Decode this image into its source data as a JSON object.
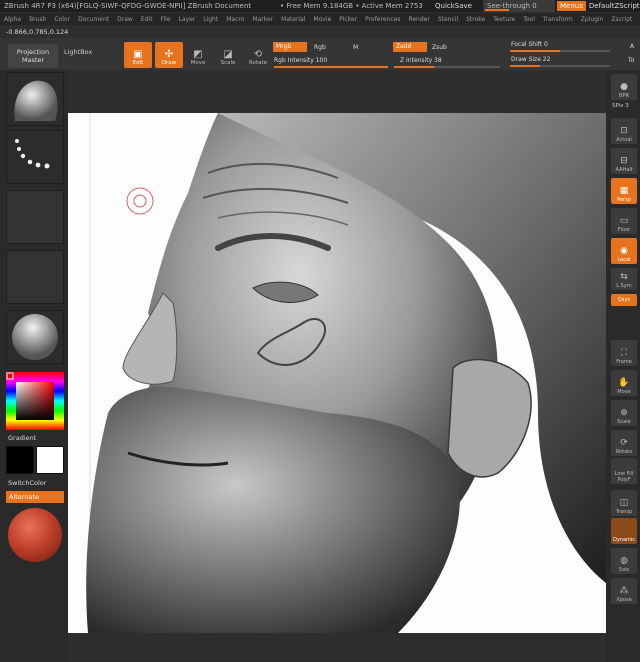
{
  "titlebar": {
    "title": "ZBrush 4R7 P3 (x64)[FGLQ-SIWF-QFDG-GWOE-NPII]   ZBrush Document",
    "memory": "• Free Mem 9.184GB • Active Mem 2753",
    "quicksave": "QuickSave",
    "see_through": "See-through  0",
    "menus": "Menus",
    "default_script": "DefaultZScript"
  },
  "menubar": [
    "Alpha",
    "Brush",
    "Color",
    "Document",
    "Draw",
    "Edit",
    "File",
    "Layer",
    "Light",
    "Macro",
    "Marker",
    "Material",
    "Movie",
    "Picker",
    "Preferences",
    "Render",
    "Stencil",
    "Stroke",
    "Texture",
    "Tool",
    "Transform",
    "Zplugin",
    "Zscript"
  ],
  "coords": "-0.866,0.785,0.124",
  "shelf": {
    "projection_master": "Projection Master",
    "lightbox": "LightBox",
    "edit": "Edit",
    "draw": "Draw",
    "move": "Move",
    "scale": "Scale",
    "rotate": "Rotate",
    "mrgb": "Mrgb",
    "rgb": "Rgb",
    "m": "M",
    "rgb_intensity": "Rgb  Intensity 100",
    "zadd": "Zadd",
    "zsub": "Zsub",
    "z_intensity": "Z Intensity 38",
    "focal_shift": "Focal Shift 0",
    "draw_size": "Draw Size 22",
    "a": "A",
    "to": "To",
    "rgb_intensity_level": 1.0,
    "z_intensity_level": 0.38,
    "focal_shift_level": 0.5,
    "draw_size_level": 0.3
  },
  "left": {
    "gradient": "Gradient",
    "switch_color": "SwitchColor",
    "alternate": "Alternate",
    "colors": {
      "main": "#ff0000",
      "black": "#000000",
      "white": "#ffffff",
      "accent": "#e8731e"
    }
  },
  "right": {
    "bpr": "BPR",
    "spix": "SPix 3",
    "actual": "Actual",
    "aahalf": "AAHalf",
    "persp": "Persp",
    "floor": "Floor",
    "local": "Local",
    "lsym": "L.Sym",
    "xyz": "Qxyz",
    "frame": "Frame",
    "move": "Move",
    "scale": "Scale",
    "rotate": "Rotate",
    "line_fill": "Line Fill",
    "polyf": "PolyF",
    "transp": "Transp",
    "dynamic": "Dynamic",
    "solo": "Solo",
    "xpose": "Xpose"
  }
}
